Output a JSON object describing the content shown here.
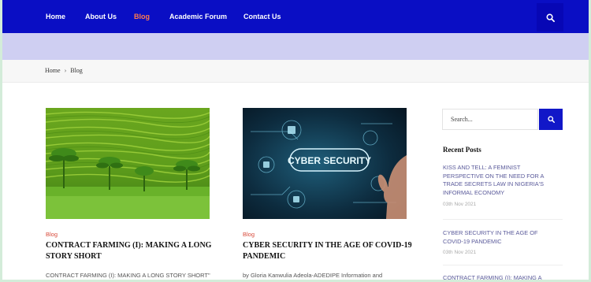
{
  "nav": {
    "items": [
      {
        "label": "Home",
        "active": false
      },
      {
        "label": "About Us",
        "active": false
      },
      {
        "label": "Blog",
        "active": true
      },
      {
        "label": "Academic Forum",
        "active": false
      },
      {
        "label": "Contact Us",
        "active": false
      }
    ],
    "search_icon": "search-icon"
  },
  "breadcrumb": {
    "home": "Home",
    "separator": "›",
    "current": "Blog"
  },
  "posts": [
    {
      "category": "Blog",
      "title_line1": "CONTRACT FARMING (I): MAKING A LONG",
      "title_line2": "STORY SHORT",
      "excerpt": "CONTRACT FARMING (I): MAKING A LONG STORY SHORT\""
    },
    {
      "category": "Blog",
      "title_line1": "CYBER SECURITY IN THE AGE OF COVID-19",
      "title_line2": "PANDEMIC",
      "excerpt": "by Gloria Kanwulia Adeola-ADEDIPE Information and",
      "image_text": "CYBER SECURITY"
    }
  ],
  "sidebar": {
    "search_placeholder": "Search...",
    "recent_posts_heading": "Recent Posts",
    "recent_posts": [
      {
        "line1": "KISS AND TELL: A FEMINIST",
        "line2": "PERSPECTIVE ON THE NEED FOR A",
        "line3": "TRADE SECRETS LAW IN NIGERIA'S",
        "line4": "INFORMAL ECONOMY",
        "date": "03th Nov 2021"
      },
      {
        "line1": "CYBER SECURITY IN THE AGE OF",
        "line2": "COVID-19 PANDEMIC",
        "date": "03th Nov 2021"
      },
      {
        "line1": "CONTRACT FARMING (I): MAKING A"
      }
    ]
  },
  "colors": {
    "nav_bg": "#0a0ec4",
    "nav_active": "#ff7a4d",
    "band": "#cfcff2",
    "category": "#d84a3a",
    "search_button": "#1117c8"
  }
}
